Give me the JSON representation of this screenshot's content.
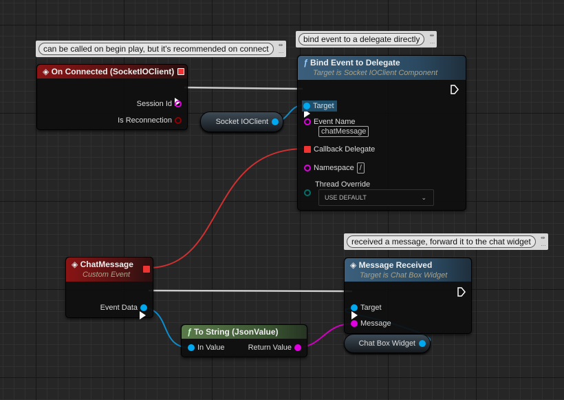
{
  "comments": [
    {
      "text": "can be called on begin play, but it's recommended on connect"
    },
    {
      "text": "bind event to a delegate directly"
    },
    {
      "text": "received a message, forward it to the chat widget"
    }
  ],
  "on_connected": {
    "title": "On Connected (SocketIOClient)",
    "pins": [
      "Session Id",
      "Is Reconnection"
    ]
  },
  "socket_var": {
    "label": "Socket IOClient"
  },
  "bind": {
    "title": "Bind Event to Delegate",
    "subtitle": "Target is Socket IOClient Component",
    "target": "Target",
    "event_name": "Event Name",
    "event_name_value": "chatMessage",
    "callback": "Callback Delegate",
    "namespace": "Namespace",
    "namespace_value": "/",
    "thread": "Thread Override",
    "thread_value": "USE DEFAULT"
  },
  "chat_event": {
    "title": "ChatMessage",
    "subtitle": "Custom Event",
    "pin": "Event Data"
  },
  "to_string": {
    "title": "To String (JsonValue)",
    "in": "In Value",
    "out": "Return Value"
  },
  "msg_received": {
    "title": "Message Received",
    "subtitle": "Target is Chat Box Widget",
    "target": "Target",
    "message": "Message"
  },
  "chat_var": {
    "label": "Chat Box Widget"
  },
  "colors": {
    "exec": "#ffffff",
    "object": "#00a8f0",
    "string": "#e000e0",
    "bool": "#900000",
    "delegate": "#ff3838",
    "enum": "#00706a"
  }
}
